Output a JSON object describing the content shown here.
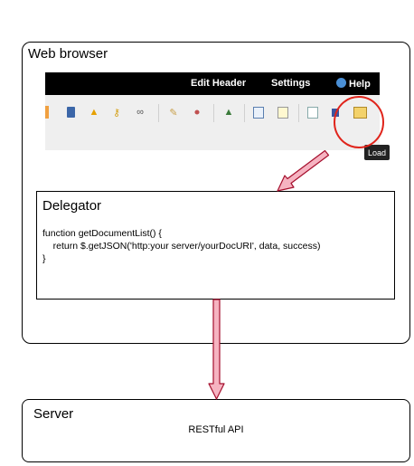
{
  "browser": {
    "title": "Web browser",
    "menu": {
      "edit_header": "Edit Header",
      "settings": "Settings",
      "help": "Help"
    },
    "tooltip": "Load",
    "icons": [
      "book-icon",
      "warning-icon",
      "key-icon",
      "link-icon",
      "pencil-icon",
      "tag-icon",
      "sitemap-icon",
      "import-icon",
      "edit-icon",
      "document-icon",
      "save-icon",
      "load-icon"
    ]
  },
  "delegator": {
    "title": "Delegator",
    "code_line1": "function getDocumentList() {",
    "code_line2": "    return $.getJSON('http:your server/yourDocURI', data, success)",
    "code_line3": "}"
  },
  "server": {
    "title": "Server",
    "subtitle": "RESTful API"
  },
  "colors": {
    "arrow_fill": "#f6b3c1",
    "arrow_stroke": "#a50f2d",
    "highlight": "#e0241b",
    "topbar": "#000000"
  }
}
